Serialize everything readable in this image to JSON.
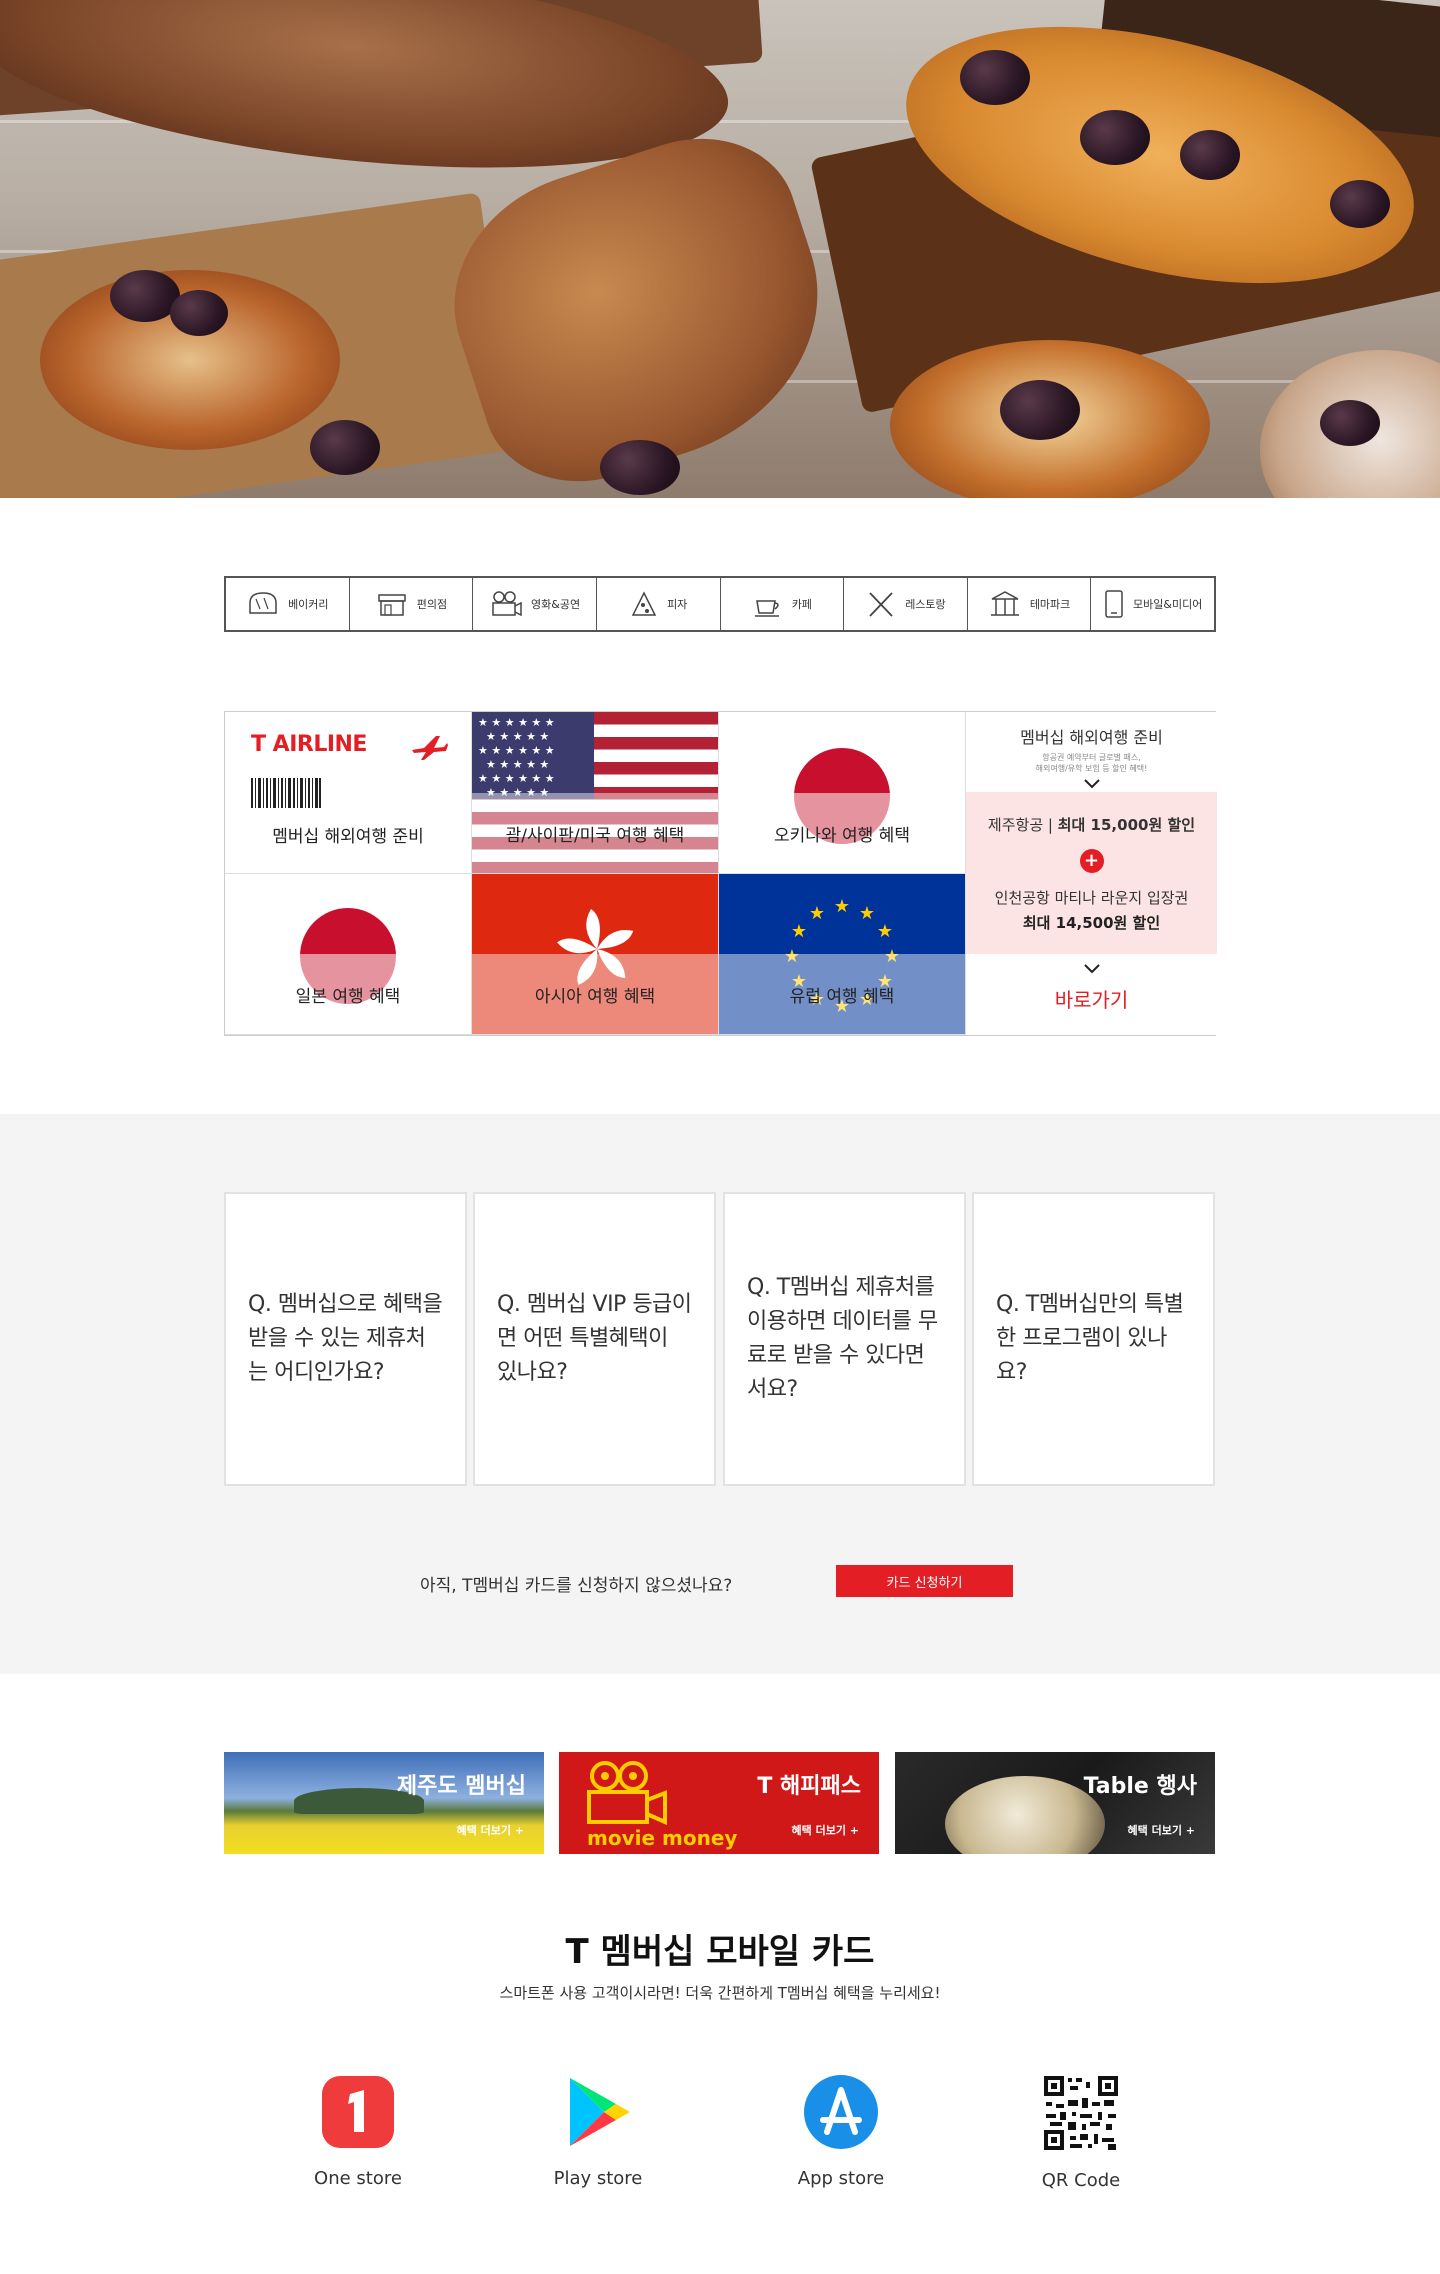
{
  "categories": [
    {
      "label": "베이커리",
      "icon": "bakery-icon"
    },
    {
      "label": "편의점",
      "icon": "store-icon"
    },
    {
      "label": "영화&공연",
      "icon": "movie-camera-icon"
    },
    {
      "label": "피자",
      "icon": "pizza-icon"
    },
    {
      "label": "카페",
      "icon": "coffee-cup-icon"
    },
    {
      "label": "레스토랑",
      "icon": "fork-knife-icon"
    },
    {
      "label": "테마파크",
      "icon": "carousel-icon"
    },
    {
      "label": "모바일&미디어",
      "icon": "smartphone-icon"
    }
  ],
  "travel": {
    "airline_logo": "T AIRLINE",
    "cells": [
      {
        "label": "멤버십 해외여행 준비"
      },
      {
        "label": "괌/사이판/미국 여행 혜택"
      },
      {
        "label": "오키나와 여행 혜택"
      },
      {
        "label": "일본 여행 혜택"
      },
      {
        "label": "아시아 여행 혜택"
      },
      {
        "label": "유럽 여행 혜택"
      }
    ],
    "side": {
      "title": "멤버십 해외여행 준비",
      "subtitle_1": "항공권 예약부터 글로벌 패스,",
      "subtitle_2": "해외여행/유학 보험 등 할인 혜택!",
      "offer1_prefix": "제주항공 |",
      "offer1_value": "최대 15,000원 할인",
      "offer2_title": "인천공항 마티나 라운지 입장권",
      "offer2_value": "최대 14,500원 할인",
      "cta": "바로가기"
    }
  },
  "faq": [
    {
      "q": "Q. 멤버십으로 혜택을 받을 수 있는 제휴처는 어디인가요?"
    },
    {
      "q": "Q. 멤버십 VIP 등급이면 어떤 특별혜택이 있나요?"
    },
    {
      "q": "Q. T멤버십 제휴처를 이용하면 데이터를 무료로 받을 수 있다면서요?"
    },
    {
      "q": "Q. T멤버십만의 특별한 프로그램이 있나요?"
    }
  ],
  "apply": {
    "text": "아직, T멤버십 카드를 신청하지 않으셨나요?",
    "button": "카드 신청하기"
  },
  "banners": [
    {
      "title": "제주도 멤버십",
      "more": "혜택 더보기 +"
    },
    {
      "title": "T 해피패스",
      "sub": "movie money",
      "more": "혜택 더보기 +"
    },
    {
      "title": "Table 행사",
      "more": "혜택 더보기 +"
    }
  ],
  "mobile": {
    "title": "T 멤버십 모바일 카드",
    "subtitle": "스마트폰 사용 고객이시라면! 더욱 간편하게 T멤버십 혜택을 누리세요!"
  },
  "apps": [
    {
      "label": "One store",
      "icon": "one-store-icon"
    },
    {
      "label": "Play store",
      "icon": "play-store-icon"
    },
    {
      "label": "App store",
      "icon": "app-store-icon"
    },
    {
      "label": "QR Code",
      "icon": "qr-code-icon"
    }
  ],
  "colors": {
    "brand_red": "#e31e24",
    "pink_bg": "#fde4e4",
    "grey_bg": "#f4f4f4"
  }
}
